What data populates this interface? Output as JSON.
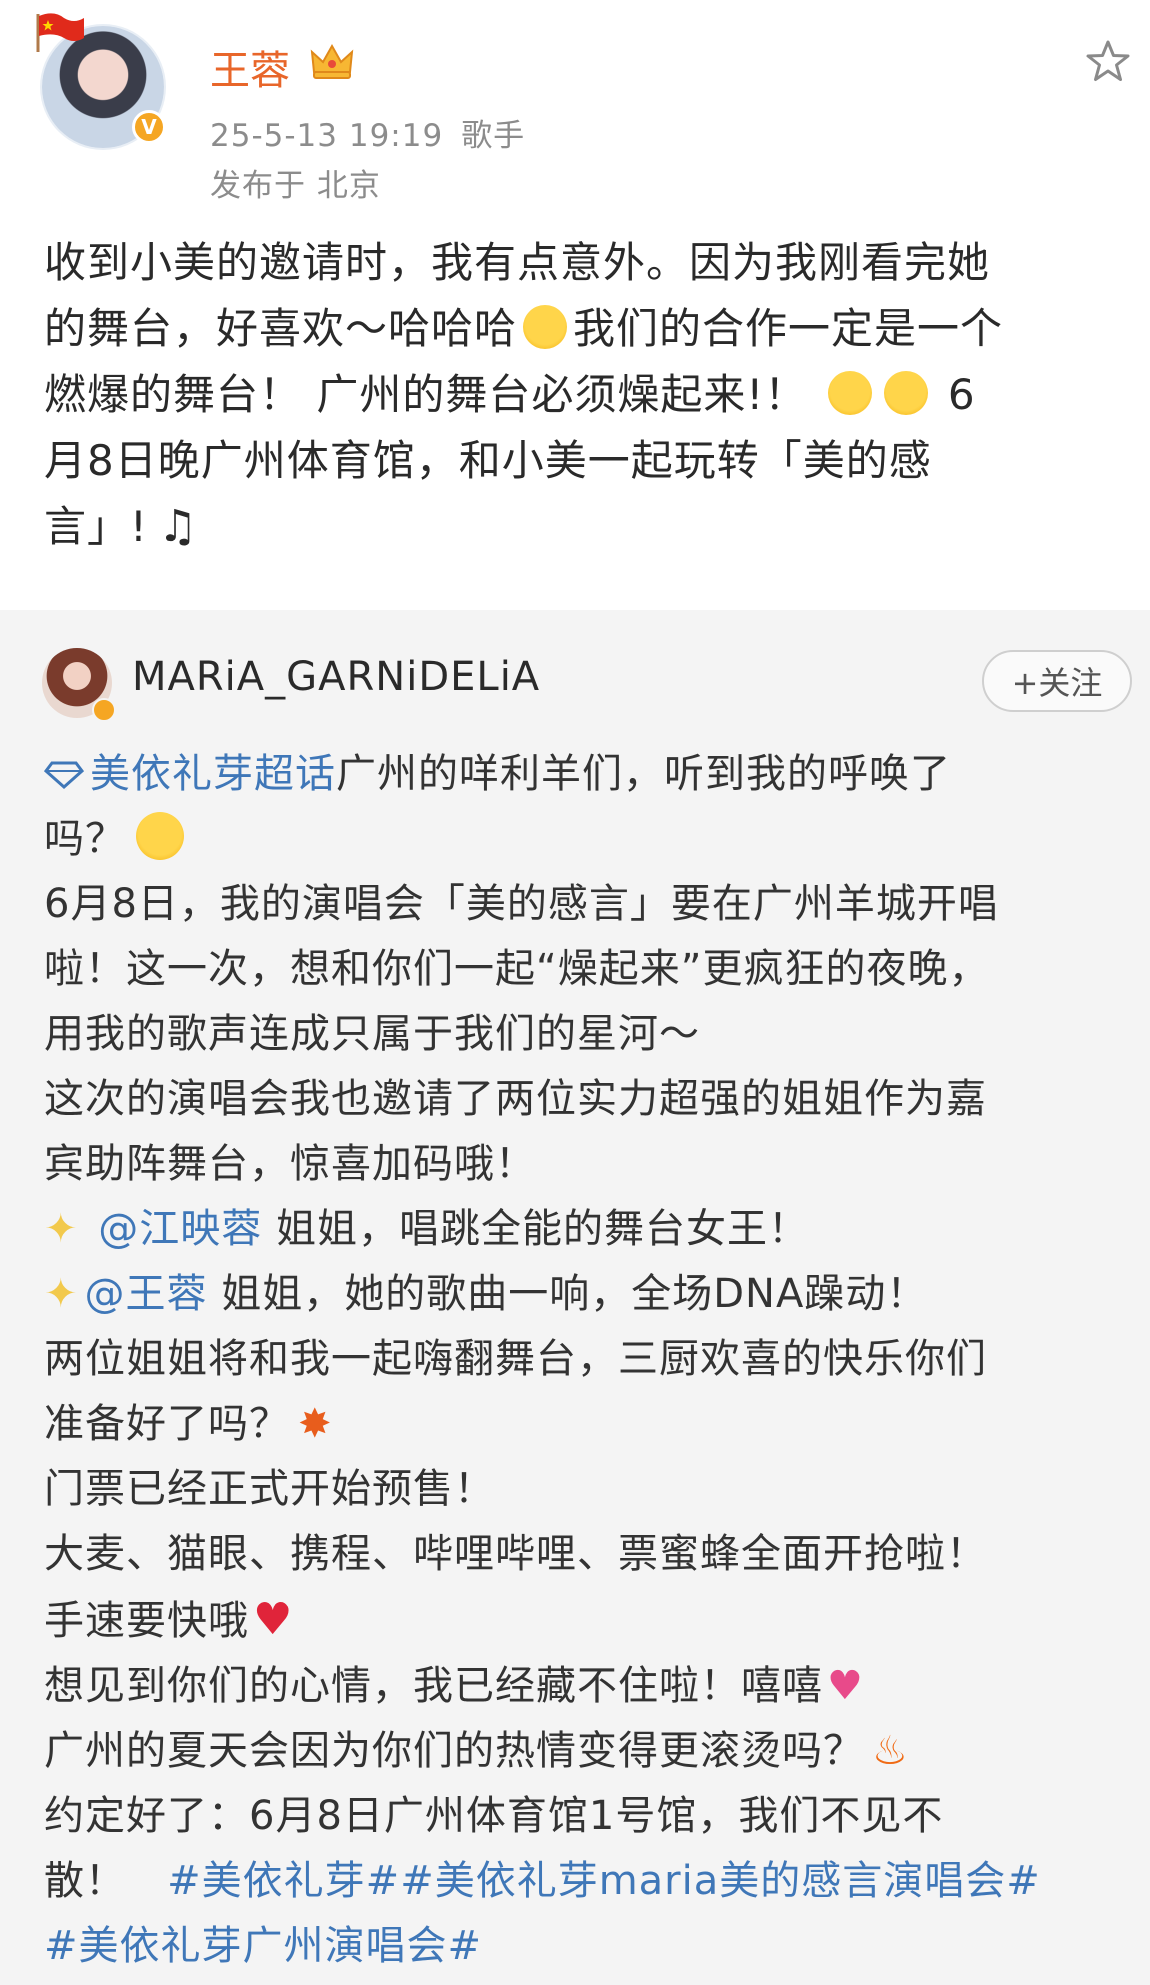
{
  "post": {
    "author": "王蓉",
    "timestamp": "25-5-13 19:19",
    "tag": "歌手",
    "location": "发布于 北京",
    "line1": "收到小美的邀请时，我有点意外。因为我刚看完她",
    "line2a": "的舞台，好喜欢～哈哈哈",
    "line2b": "我们的合作一定是一个",
    "line3a": "燃爆的舞台！ 广州的舞台必须燥起来!！",
    "line3b": " 6",
    "line4": "月8日晚广州体育馆，和小美一起玩转「美的感",
    "line5": "言」!"
  },
  "repost": {
    "author": "MARiA_GARNiDELiA",
    "follow_label": "+关注",
    "super_topic": "美依礼芽超话",
    "r1": "广州的咩利羊们，听到我的呼唤了",
    "r2": "吗？",
    "r3": "6月8日，我的演唱会「美的感言」要在广州羊城开唱",
    "r4": "啦！这一次，想和你们一起“燥起来”更疯狂的夜晚，",
    "r5": "用我的歌声连成只属于我们的星河～",
    "r6": "这次的演唱会我也邀请了两位实力超强的姐姐作为嘉",
    "r7": "宾助阵舞台，惊喜加码哦！",
    "mention1": "@江映蓉",
    "r8": " 姐姐，唱跳全能的舞台女王！",
    "mention2": "@王蓉",
    "r9": " 姐姐，她的歌曲一响，全场DNA躁动！",
    "r10": "两位姐姐将和我一起嗨翻舞台，三厨欢喜的快乐你们",
    "r11": "准备好了吗？",
    "r12": "门票已经正式开始预售！",
    "r13": "大麦、猫眼、携程、哔哩哔哩、票蜜蜂全面开抢啦！",
    "r14": "手速要快哦",
    "r15": "想见到你们的心情，我已经藏不住啦！嘻嘻",
    "r16": "广州的夏天会因为你们的热情变得更滚烫吗？",
    "r17": "约定好了：6月8日广州体育馆1号馆，我们不见不",
    "r18": "散！",
    "hashtag1": "#美依礼芽#",
    "hashtag2": "#美依礼芽maria美的感言演唱会#",
    "hashtag3": "#美依礼芽广州演唱会#"
  },
  "icons": {
    "flag": "china-flag-icon",
    "crown": "crown-icon",
    "star": "star-icon",
    "verify": "verified-badge-icon",
    "supertopic": "diamond-icon"
  },
  "colors": {
    "author_name": "#e8662a",
    "link": "#3f77b8",
    "meta": "#8c8c8c",
    "repost_bg": "#f4f4f4"
  }
}
